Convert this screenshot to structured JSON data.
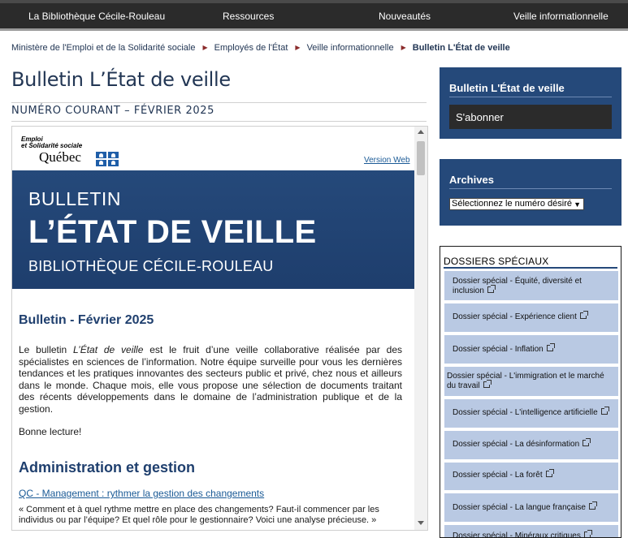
{
  "topnav": {
    "items": [
      "La Bibliothèque Cécile-Rouleau",
      "Ressources",
      "Nouveautés",
      "Veille informationnelle"
    ]
  },
  "breadcrumb": {
    "items": [
      "Ministère de l'Emploi et de la Solidarité sociale",
      "Employés de l'État",
      "Veille informationnelle"
    ],
    "current": "Bulletin L'État de veille"
  },
  "page": {
    "title": "Bulletin L’État de veille",
    "issue": "NUMÉRO COURANT – FÉVRIER 2025"
  },
  "newsletter": {
    "logo_line1": "Emploi",
    "logo_line2": "et Solidarité sociale",
    "logo_quebec": "Québec",
    "web_version": "Version Web",
    "banner_line1": "BULLETIN",
    "banner_line2": "L’ÉTAT DE VEILLE",
    "banner_line3": "BIBLIOTHÈQUE CÉCILE-ROULEAU",
    "title": "Bulletin - Février 2025",
    "intro_pre": "Le bulletin ",
    "intro_em": "L’État de veille",
    "intro_post": " est le fruit d’une veille collaborative réalisée par des spécialistes en sciences de l’information. Notre équipe surveille pour vous les dernières tendances et les pratiques innovantes des secteurs public et privé, chez nous et ailleurs dans le monde. Chaque mois, elle vous propose une sélection de documents traitant des récents développements dans le domaine de l’administration publique et de la gestion.",
    "greeting": "Bonne lecture!",
    "section_title": "Administration et gestion",
    "article_link": "QC - Management : rythmer la gestion des changements",
    "article_quote": "« Comment et à quel rythme mettre en place des changements? Faut-il commencer par les individus ou par l’équipe? Et quel rôle pour le gestionnaire? Voici une analyse précieuse. »"
  },
  "sidebar": {
    "bulletin_title": "Bulletin L'État de veille",
    "subscribe_label": "S'abonner",
    "archives_title": "Archives",
    "archives_select": "Sélectionnez le numéro désiré",
    "dossiers_title": "DOSSIERS SPÉCIAUX",
    "dossiers": [
      "Dossier spécial - Équité, diversité et inclusion",
      "Dossier spécial - Expérience client",
      "Dossier spécial - Inflation",
      "Dossier spécial - L'immigration et le marché du travail",
      "Dossier spécial - L'intelligence artificielle",
      "Dossier spécial - La désinformation",
      "Dossier spécial - La forêt",
      "Dossier spécial - La langue française",
      "Dossier spécial - Minéraux critiques"
    ]
  },
  "colors": {
    "nav_bg": "#2b2b2b",
    "brand_blue": "#25497a",
    "dossier_bg": "#b9c9e3",
    "link": "#1a5a96"
  }
}
